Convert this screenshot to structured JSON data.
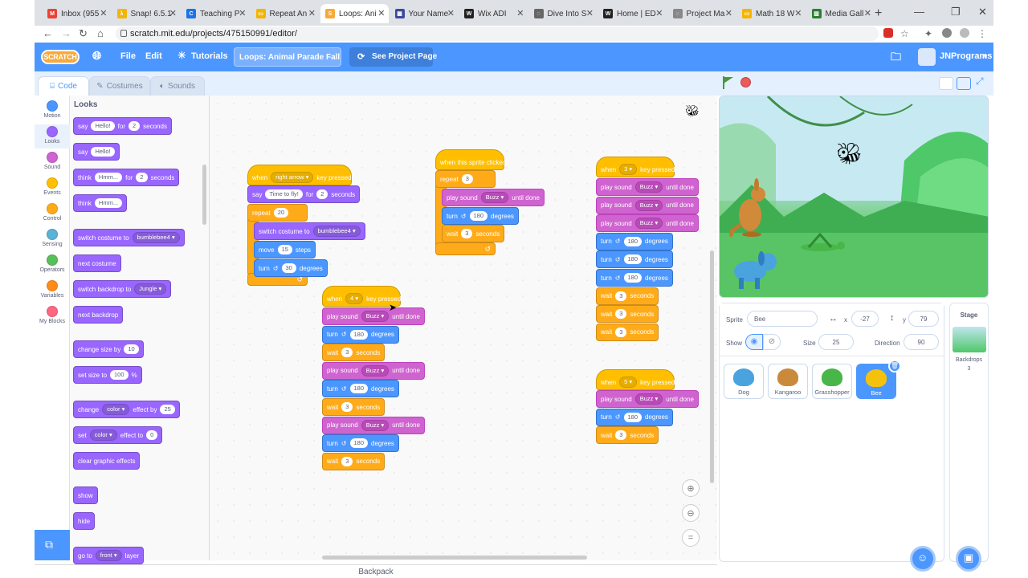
{
  "browser": {
    "tabs": [
      {
        "label": "Inbox (955",
        "color": "#ea4335",
        "glyph": "M"
      },
      {
        "label": "Snap! 6.5.1",
        "color": "#f5b400",
        "glyph": "λ"
      },
      {
        "label": "Teaching P",
        "color": "#1a73e8",
        "glyph": "C"
      },
      {
        "label": "Repeat An",
        "color": "#f4b400",
        "glyph": "▭"
      },
      {
        "label": "Loops: Ani",
        "color": "#f7a93a",
        "glyph": "S"
      },
      {
        "label": "Your Name",
        "color": "#3c4b9b",
        "glyph": "▦"
      },
      {
        "label": "Wix ADI",
        "color": "#222",
        "glyph": "W"
      },
      {
        "label": "Dive Into S",
        "color": "#666",
        "glyph": "◌"
      },
      {
        "label": "Home | ED",
        "color": "#222",
        "glyph": "W"
      },
      {
        "label": "Project Ma",
        "color": "#888",
        "glyph": "◌"
      },
      {
        "label": "Math 18 W",
        "color": "#f4b400",
        "glyph": "▭"
      },
      {
        "label": "Media Gall",
        "color": "#2e7d32",
        "glyph": "▨"
      }
    ],
    "url": "scratch.mit.edu/projects/475150991/editor/"
  },
  "menu": {
    "logo": "SCRATCH",
    "file": "File",
    "edit": "Edit",
    "tutorials": "Tutorials",
    "project_title": "Loops: Animal Parade Fall...",
    "see_project": "See Project Page",
    "user": "JNPrograms"
  },
  "editor_tabs": {
    "code": "Code",
    "costumes": "Costumes",
    "sounds": "Sounds"
  },
  "categories": [
    {
      "label": "Motion",
      "color": "#4c97ff"
    },
    {
      "label": "Looks",
      "color": "#9966ff"
    },
    {
      "label": "Sound",
      "color": "#cf63cf"
    },
    {
      "label": "Events",
      "color": "#ffbf00"
    },
    {
      "label": "Control",
      "color": "#ffab19"
    },
    {
      "label": "Sensing",
      "color": "#5cb1d6"
    },
    {
      "label": "Operators",
      "color": "#59c059"
    },
    {
      "label": "Variables",
      "color": "#ff8c1a"
    },
    {
      "label": "My Blocks",
      "color": "#ff6680"
    }
  ],
  "palette": {
    "heading": "Looks",
    "say_for": {
      "say": "say",
      "msg": "Hello!",
      "for": "for",
      "n": "2",
      "unit": "seconds"
    },
    "say": {
      "say": "say",
      "msg": "Hello!"
    },
    "think_for": {
      "think": "think",
      "msg": "Hmm...",
      "for": "for",
      "n": "2",
      "unit": "seconds"
    },
    "think": {
      "think": "think",
      "msg": "Hmm..."
    },
    "switch_costume": {
      "label": "switch costume to",
      "value": "bumblebee4"
    },
    "next_costume": "next costume",
    "switch_backdrop": {
      "label": "switch backdrop to",
      "value": "Jungle"
    },
    "next_backdrop": "next backdrop",
    "change_size": {
      "label": "change size by",
      "value": "10"
    },
    "set_size": {
      "label": "set size to",
      "value": "100",
      "unit": "%"
    },
    "change_effect": {
      "label": "change",
      "effect": "color",
      "by": "effect by",
      "value": "25"
    },
    "set_effect": {
      "label": "set",
      "effect": "color",
      "to": "effect to",
      "value": "0"
    },
    "clear_effects": "clear graphic effects",
    "show": "show",
    "hide": "hide",
    "go_to": {
      "label": "go to",
      "value": "front",
      "layer": "layer"
    }
  },
  "scripts": {
    "s1": {
      "when": "when",
      "key": "right arrow",
      "pressed": "key pressed",
      "say": "say",
      "msg": "Time to fly!",
      "for": "for",
      "n": "2",
      "seconds": "seconds",
      "repeat": "repeat",
      "times": "20",
      "costume": "switch costume to",
      "costume_val": "bumblebee4",
      "move": "move",
      "steps_n": "15",
      "steps": "steps",
      "turn": "turn",
      "deg_n": "30",
      "degrees": "degrees"
    },
    "s2": {
      "hat": "when this sprite clicked",
      "repeat": "repeat",
      "times": "3",
      "play": "play sound",
      "sound": "Buzz",
      "until": "until done",
      "turn": "turn",
      "deg_n": "180",
      "degrees": "degrees",
      "wait": "wait",
      "wait_n": "3",
      "seconds": "seconds"
    },
    "s3": {
      "when": "when",
      "key": "3",
      "pressed": "key pressed",
      "play": "play sound",
      "sound": "Buzz",
      "until": "until done",
      "turn": "turn",
      "deg_n": "180",
      "degrees": "degrees",
      "wait": "wait",
      "wait_n": "3",
      "seconds": "seconds"
    },
    "s4": {
      "when": "when",
      "key": "4",
      "pressed": "key pressed",
      "play": "play sound",
      "sound": "Buzz",
      "until": "until done",
      "turn": "turn",
      "deg_n": "180",
      "degrees": "degrees",
      "wait": "wait",
      "wait_n": "3",
      "seconds": "seconds"
    },
    "s5": {
      "when": "when",
      "key": "5",
      "pressed": "key pressed",
      "play": "play sound",
      "sound": "Buzz",
      "until": "until done",
      "turn": "turn",
      "deg_n": "180",
      "degrees": "degrees",
      "wait": "wait",
      "wait_n": "3",
      "seconds": "seconds"
    }
  },
  "backpack": "Backpack",
  "sprite_info": {
    "sprite_label": "Sprite",
    "sprite_name": "Bee",
    "x_label": "x",
    "x": "-27",
    "y_label": "y",
    "y": "79",
    "show_label": "Show",
    "size_label": "Size",
    "size": "25",
    "direction_label": "Direction",
    "direction": "90"
  },
  "sprites": [
    {
      "name": "Dog",
      "color": "#4aa3df"
    },
    {
      "name": "Kangaroo",
      "color": "#c98a3c"
    },
    {
      "name": "Grasshopper",
      "color": "#49b64a"
    },
    {
      "name": "Bee",
      "color": "#f4c20d"
    }
  ],
  "stage_pane": {
    "title": "Stage",
    "backdrops_label": "Backdrops",
    "backdrops_count": "3"
  }
}
